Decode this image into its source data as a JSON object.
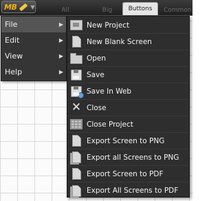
{
  "app": {
    "logo_text": "MB",
    "logo_icon": "pencil-icon",
    "logo_color": "#f2b21c"
  },
  "tabs": [
    {
      "label": "All",
      "active": false
    },
    {
      "label": "Big",
      "active": false
    },
    {
      "label": "Buttons",
      "active": true
    },
    {
      "label": "Common",
      "active": false
    }
  ],
  "main_menu": {
    "items": [
      {
        "label": "File",
        "has_submenu": true,
        "active": true
      },
      {
        "label": "Edit",
        "has_submenu": true,
        "active": false
      },
      {
        "label": "View",
        "has_submenu": true,
        "active": false
      },
      {
        "label": "Help",
        "has_submenu": true,
        "active": false
      }
    ]
  },
  "file_submenu": {
    "items": [
      {
        "label": "New Project",
        "icon": "new-project-icon"
      },
      {
        "label": "New Blank Screen",
        "icon": "blank-document-icon"
      },
      {
        "label": "Open",
        "icon": "folder-icon"
      },
      {
        "label": "Save",
        "icon": "save-disk-icon"
      },
      {
        "label": "Save In Web",
        "icon": "save-web-icon"
      },
      {
        "label": "Close",
        "icon": "close-icon"
      },
      {
        "label": "Close Project",
        "icon": "close-project-icon"
      },
      {
        "label": "Export Screen to PNG",
        "icon": "export-png-icon"
      },
      {
        "label": "Export all Screens to PNG",
        "icon": "export-all-png-icon"
      },
      {
        "label": "Export Screen to PDF",
        "icon": "export-pdf-icon"
      },
      {
        "label": "Export All Screens to PDF",
        "icon": "export-all-pdf-icon"
      }
    ]
  }
}
